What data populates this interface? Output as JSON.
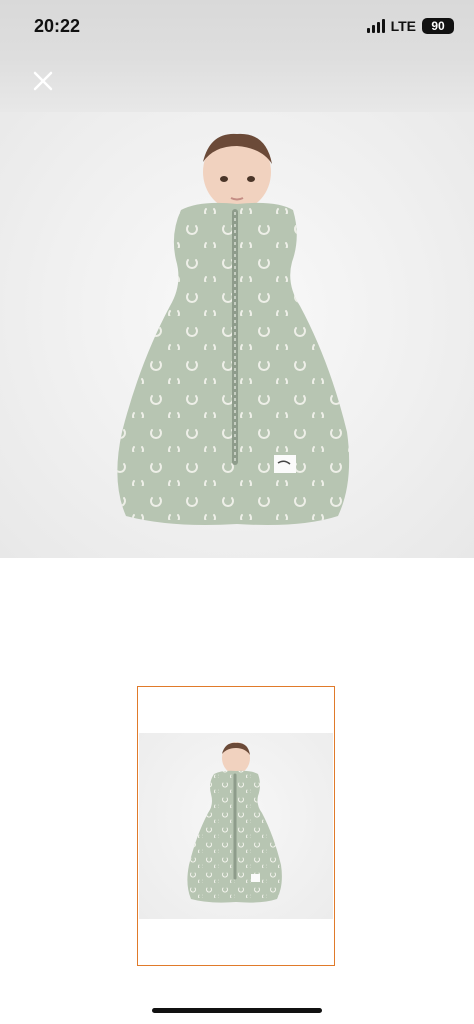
{
  "status_bar": {
    "time": "20:22",
    "network": "LTE",
    "battery": "90"
  },
  "toolbar": {
    "close_icon": "close-icon"
  },
  "product": {
    "main_image": "baby-sleep-sack-photo",
    "thumbnail_image": "baby-sleep-sack-thumbnail",
    "selected_thumbnail_border": "#e07a2a",
    "sack_color": "#b7c5b2"
  }
}
